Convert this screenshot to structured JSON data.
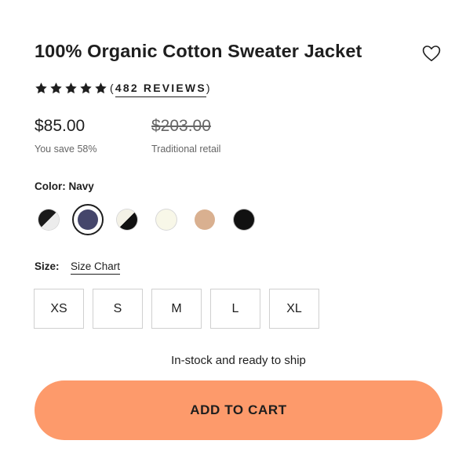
{
  "product": {
    "title": "100% Organic Cotton Sweater Jacket",
    "wishlist_icon": "heart-outline-icon"
  },
  "rating": {
    "stars": 5,
    "open_paren": "(",
    "reviews_label": "482 REVIEWS",
    "close_paren": ")"
  },
  "pricing": {
    "price": "$85.00",
    "savings": "You save 58%",
    "retail_price": "$203.00",
    "retail_label": "Traditional retail"
  },
  "color": {
    "label_prefix": "Color:",
    "selected": "Navy",
    "swatches": [
      {
        "name": "black-white-split",
        "colors": [
          "#1a1a1a",
          "#ececec"
        ]
      },
      {
        "name": "navy",
        "colors": [
          "#45466b"
        ],
        "selected": true
      },
      {
        "name": "white-black-split",
        "colors": [
          "#f3f1e6",
          "#111111"
        ]
      },
      {
        "name": "ivory",
        "colors": [
          "#f8f7e8"
        ]
      },
      {
        "name": "tan",
        "colors": [
          "#d9b090"
        ]
      },
      {
        "name": "black",
        "colors": [
          "#111111"
        ]
      }
    ]
  },
  "size": {
    "label": "Size:",
    "chart_link": "Size Chart",
    "options": [
      "XS",
      "S",
      "M",
      "L",
      "XL"
    ]
  },
  "stock_status": "In-stock and ready to ship",
  "cart": {
    "label": "ADD TO CART",
    "color": "#fd9a6b"
  }
}
